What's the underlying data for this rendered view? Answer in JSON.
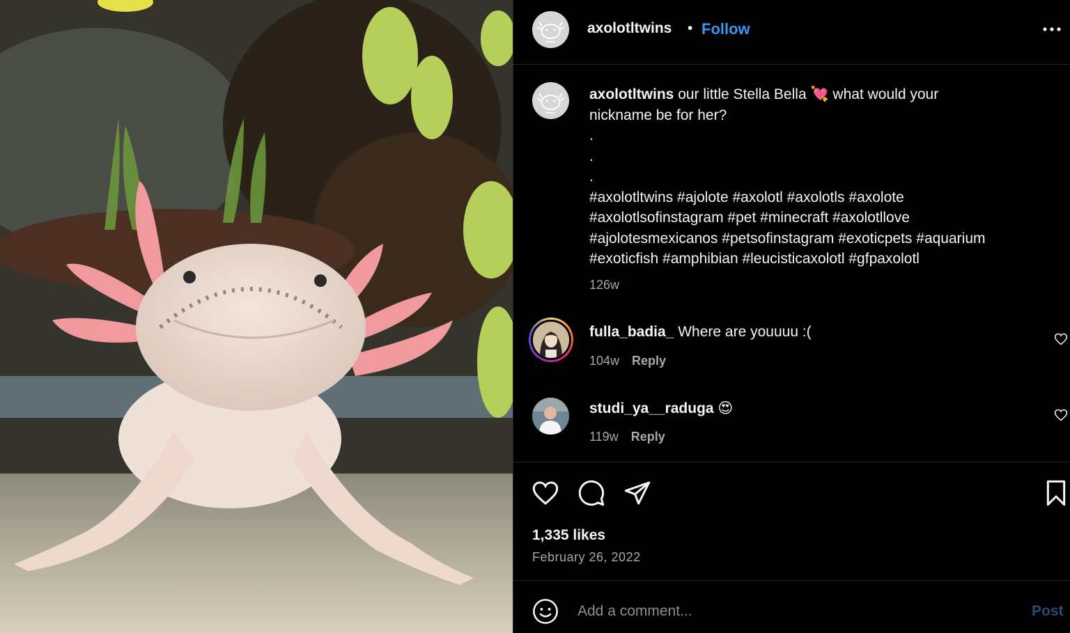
{
  "post": {
    "username": "axolotltwins",
    "dot": "•",
    "follow_label": "Follow",
    "more_icon": "more-horizontal-icon",
    "photo_subject": "pink axolotl in aquarium"
  },
  "caption": {
    "username": "axolotltwins",
    "text_line1": " our little Stella Bella 💘 what would your",
    "text_line2": "nickname be for her?",
    "dot1": ".",
    "dot2": ".",
    "dot3": ".",
    "tags_line1": "#axolotltwins #ajolote #axolotl #axolotls #axolote",
    "tags_line2": "#axolotlsofinstagram #pet #minecraft #axolotllove",
    "tags_line3": "#ajolotesmexicanos #petsofinstagram #exoticpets #aquarium",
    "tags_line4": "#exoticfish #amphibian #leucisticaxolotl #gfpaxolotl",
    "time": "126w"
  },
  "comments": [
    {
      "username": "fulla_badia_",
      "text": " Where are youuuu :(",
      "time": "104w",
      "reply_label": "Reply"
    },
    {
      "username": "studi_ya__raduga",
      "text": " 😍",
      "time": "119w",
      "reply_label": "Reply"
    }
  ],
  "actions": {
    "like_icon": "heart-icon",
    "comment_icon": "comment-bubble-icon",
    "share_icon": "paper-plane-icon",
    "save_icon": "bookmark-icon",
    "likes": "1,335 likes",
    "date": "February 26, 2022"
  },
  "add_comment": {
    "placeholder": "Add a comment...",
    "post_label": "Post"
  },
  "colors": {
    "background": "#000000",
    "link": "#3897f0",
    "muted": "#a8a8a8",
    "post_disabled": "#2c4a6b"
  }
}
